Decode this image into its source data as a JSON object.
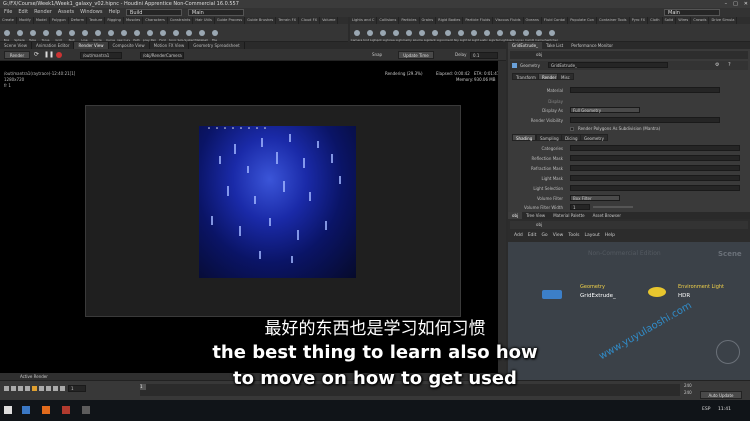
{
  "window": {
    "title": "G:/FX/Course/Week1/Week1_galaxy_v02.hipnc - Houdini Apprentice Non-Commercial 16.0.557"
  },
  "menu": {
    "items": [
      "File",
      "Edit",
      "Render",
      "Assets",
      "Windows",
      "Help"
    ],
    "build_label": "Build",
    "main_left": "Main",
    "main_right": "Main"
  },
  "shelf_left": {
    "tabs": [
      "Create",
      "Modify",
      "Model",
      "Polygon",
      "Deform",
      "Texture",
      "Rigging",
      "Muscles",
      "Characters",
      "Constraints",
      "Hair Utils",
      "Guide Process",
      "Guide Brushes",
      "Terrain FX",
      "Cloud FX",
      "Volume"
    ],
    "tools": [
      "Box",
      "Sphere",
      "Tube",
      "Torus",
      "Grid",
      "Null",
      "Line",
      "Circle",
      "Curve",
      "Draw Curve",
      "Path",
      "Spray Paint",
      "Font",
      "Platonic Solids",
      "L-System",
      "Metaball",
      "File"
    ]
  },
  "shelf_right": {
    "tabs": [
      "Lights and C",
      "Collisions",
      "Particles",
      "Grains",
      "Rigid Bodies",
      "Particle Fluids",
      "Viscous Fluids",
      "Oceans",
      "Fluid Contai",
      "Populate Con",
      "Container Tools",
      "Pyro FX",
      "Cloth",
      "Solid",
      "Wires",
      "Crowds",
      "Drive Simula"
    ],
    "tools": [
      "Camera",
      "Point Light",
      "Spot Light",
      "Area Light",
      "Geometry Light",
      "Volume Light",
      "Distant Light",
      "Environment Light",
      "Sky Light",
      "GI Light",
      "Caustic Light",
      "Portal Light",
      "Ambient Light",
      "Stereo Camera",
      "VR Camera",
      "Switcher"
    ]
  },
  "pane_tabs_left": [
    "Scene View",
    "Animation Editor",
    "Render View",
    "Composite View",
    "Motion FX View",
    "Geometry Spreadsheet"
  ],
  "viewport": {
    "render_btn": "Render",
    "camera_path": "/out/mantra1",
    "cam": "/obj/RenderCamera",
    "snap_label": "Snap",
    "update_time": "Update Time",
    "delay_label": "Delay",
    "delay_value": "0.1",
    "info_line1": "/out/mantra1(raytrace)-12:40:21[1]",
    "info_line2": "1280x720",
    "info_line3": "fr 1",
    "rendering": "Rendering (29.3%)",
    "elapsed": "Elapsed: 0:00:42",
    "eta": "ETA: 0:01:41",
    "memory": "Memory:",
    "memory_val": "930.06 MB"
  },
  "right_tabs": [
    "GridExtrude_",
    "Take List",
    "Performance Monitor"
  ],
  "params": {
    "path": "obj",
    "node_type": "Geometry",
    "node_name": "GridExtrude_",
    "tabs": [
      "Transform",
      "Render",
      "Misc"
    ],
    "material_label": "Material",
    "display_label": "Display",
    "display_as_label": "Display As",
    "display_as_value": "Full Geometry",
    "render_vis_label": "Render Visibility",
    "render_polys": "Render Polygons As Subdivision (Mantra)",
    "subtabs": [
      "Shading",
      "Sampling",
      "Dicing",
      "Geometry"
    ],
    "rows": [
      "Categories",
      "Reflection Mask",
      "Refraction Mask",
      "Light Mask",
      "Light Selection",
      "Volume Filter",
      "Volume Filter Width"
    ],
    "volume_filter_value": "Box Filter",
    "volume_filter_width": "1"
  },
  "net": {
    "tabs": [
      "obj",
      "Tree View",
      "Material Palette",
      "Asset Browser"
    ],
    "path": "obj",
    "menu": [
      "Add",
      "Edit",
      "Go",
      "View",
      "Tools",
      "Layout",
      "Help"
    ],
    "watermark": "Non-Commercial Edition",
    "scene_label": "Scene",
    "node1_type": "Geometry",
    "node1_name": "GridExtrude_",
    "node2_type": "Environment Light",
    "node2_name": "HDR",
    "site_watermark": "www.yuyulaoshi.com"
  },
  "playbar": {
    "frame": "1",
    "start": "1",
    "end": "1",
    "end_frame1": "240",
    "end_frame2": "240",
    "auto_update": "Auto Update",
    "active_render": "Active Render"
  },
  "taskbar": {
    "lang": "ESP",
    "time": "11:41"
  },
  "subtitles": {
    "line1": "最好的东西也是学习如何习惯",
    "line2": "the best thing to learn also how",
    "line3": "to move on how to get used"
  }
}
